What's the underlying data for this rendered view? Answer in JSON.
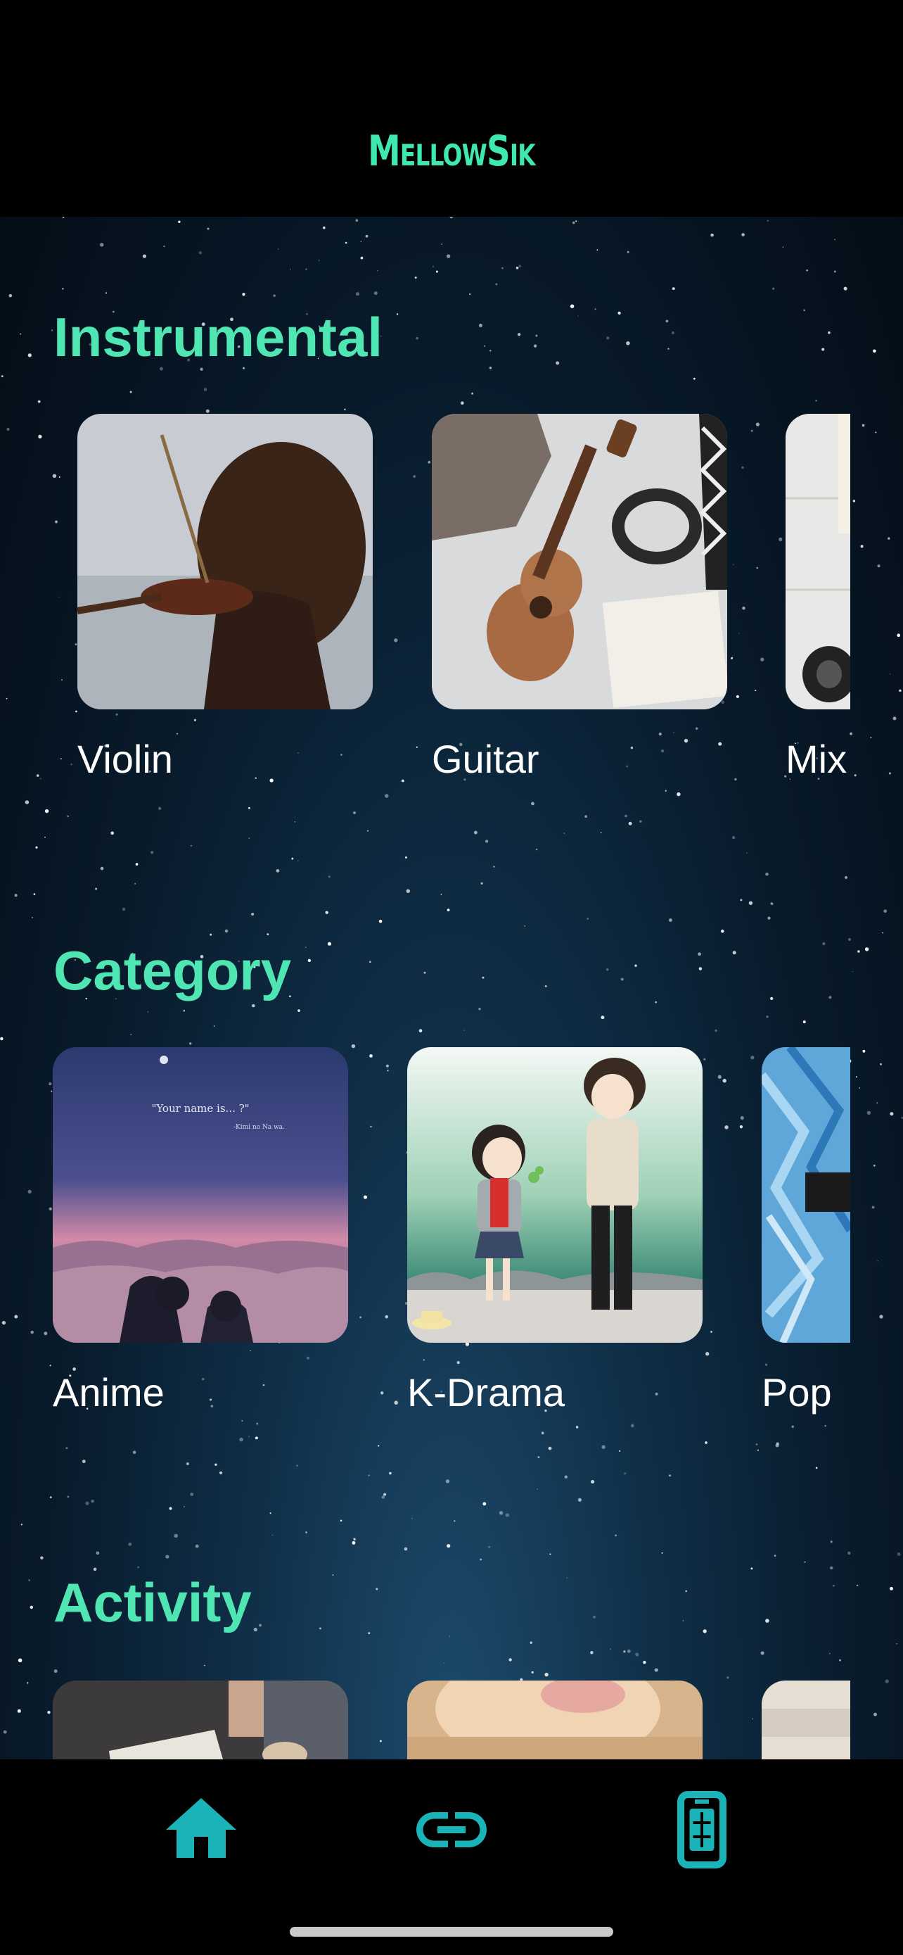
{
  "app": {
    "title": "MellowSik"
  },
  "sections": [
    {
      "title": "Instrumental",
      "items": [
        {
          "label": "Violin"
        },
        {
          "label": "Guitar"
        },
        {
          "label": "Mix"
        }
      ]
    },
    {
      "title": "Category",
      "items": [
        {
          "label": "Anime"
        },
        {
          "label": "K-Drama"
        },
        {
          "label": "Pop"
        }
      ]
    },
    {
      "title": "Activity",
      "items": [
        {
          "label": ""
        },
        {
          "label": ""
        },
        {
          "label": ""
        }
      ]
    }
  ],
  "artwork_text": {
    "anime_quote": "\"Your name is... ?\"",
    "anime_source": "-Kimi no Na wa."
  },
  "bottom_nav": [
    {
      "icon": "home-icon"
    },
    {
      "icon": "link-icon"
    },
    {
      "icon": "mobile-icon"
    }
  ],
  "colors": {
    "accent": "#4fe6b4",
    "nav_icon": "#19b3b8",
    "background": "#000000"
  }
}
